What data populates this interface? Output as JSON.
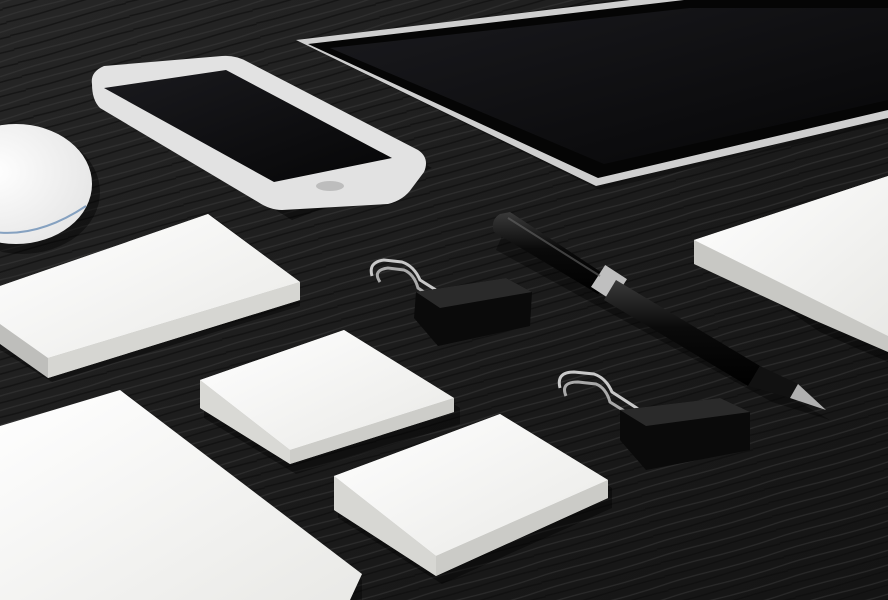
{
  "scene": {
    "background": "dark wood desk",
    "colors": {
      "desk": "#1e1e1e",
      "desk_grain": "#2c2c2c",
      "paper": "#f4f4f2",
      "paper_edge": "#cfcfcb",
      "device_frame": "#d8d8d8",
      "screen": "#0d0d0f",
      "metal": "#b9b9b9",
      "black": "#0b0b0b"
    },
    "objects": [
      "smartphone",
      "tablet",
      "cd-disc",
      "notepad-stack-large",
      "notepad-stack-medium",
      "notepad-stack-small",
      "letter-sheet",
      "notepad-right",
      "binder-clip",
      "binder-clip",
      "pen"
    ]
  }
}
